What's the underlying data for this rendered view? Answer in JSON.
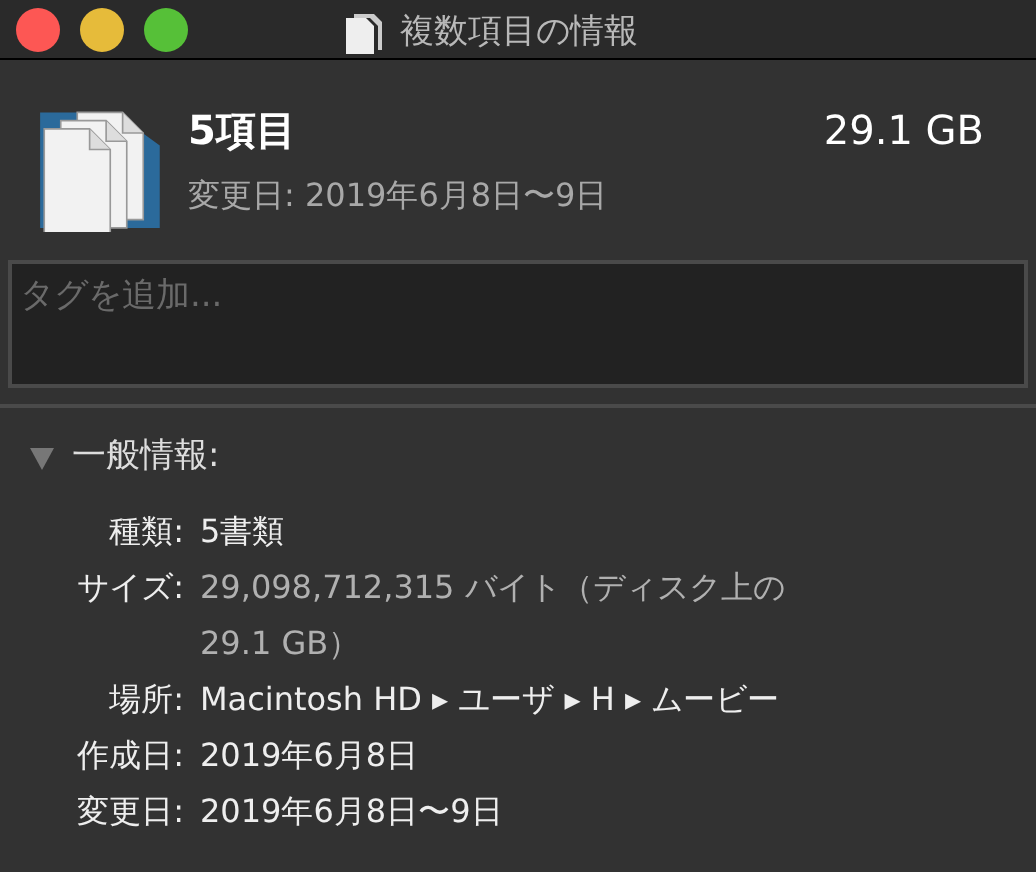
{
  "window": {
    "title": "複数項目の情報"
  },
  "header": {
    "name": "5項目",
    "size": "29.1 GB",
    "modified": "変更日: 2019年6月8日〜9日"
  },
  "tags": {
    "placeholder": "タグを追加..."
  },
  "section": {
    "title": "一般情報:",
    "expanded": true,
    "rows": [
      {
        "label": "種類:",
        "value": "5書類",
        "dim": false
      },
      {
        "label": "サイズ:",
        "value": "29,098,712,315 バイト（ディスク上の 29.1 GB）",
        "dim": true
      },
      {
        "label": "場所:",
        "value": "Macintosh HD ▸ ユーザ ▸ H ▸ ムービー",
        "dim": false
      },
      {
        "label": "作成日:",
        "value": "2019年6月8日",
        "dim": false
      },
      {
        "label": "変更日:",
        "value": "2019年6月8日〜9日",
        "dim": false
      }
    ]
  }
}
